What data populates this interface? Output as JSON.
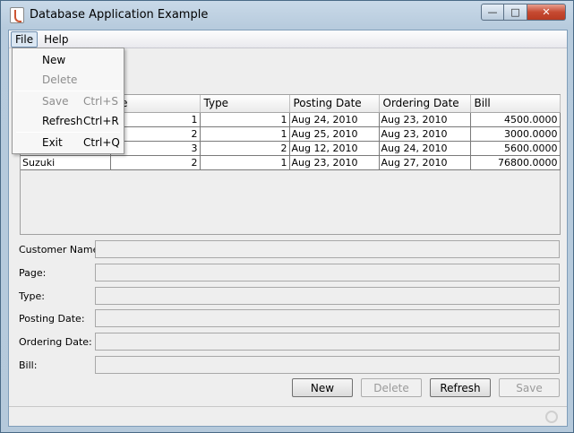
{
  "window": {
    "title": "Database Application Example"
  },
  "window_controls": {
    "minimize": "—",
    "maximize": "□",
    "close": "✕"
  },
  "menubar": {
    "items": [
      {
        "label": "File"
      },
      {
        "label": "Help"
      }
    ]
  },
  "file_menu": {
    "items": [
      {
        "label": "New",
        "accelerator": "",
        "enabled": true
      },
      {
        "label": "Delete",
        "accelerator": "",
        "enabled": false
      },
      {
        "label": "Save",
        "accelerator": "Ctrl+S",
        "enabled": false
      },
      {
        "label": "Refresh",
        "accelerator": "Ctrl+R",
        "enabled": true
      },
      {
        "label": "Exit",
        "accelerator": "Ctrl+Q",
        "enabled": true
      }
    ]
  },
  "table": {
    "columns": [
      "",
      "ge",
      "Type",
      "Posting Date",
      "Ordering Date",
      "Bill"
    ],
    "rows": [
      [
        "",
        "1",
        "1",
        "Aug 24, 2010",
        "Aug 23, 2010",
        "4500.0000"
      ],
      [
        "",
        "2",
        "1",
        "Aug 25, 2010",
        "Aug 23, 2010",
        "3000.0000"
      ],
      [
        "",
        "3",
        "2",
        "Aug 12, 2010",
        "Aug 24, 2010",
        "5600.0000"
      ],
      [
        "Suzuki",
        "2",
        "1",
        "Aug 23, 2010",
        "Aug 27, 2010",
        "76800.0000"
      ]
    ]
  },
  "form": {
    "fields": [
      {
        "label": "Customer Name:",
        "value": ""
      },
      {
        "label": "Page:",
        "value": ""
      },
      {
        "label": "Type:",
        "value": ""
      },
      {
        "label": "Posting Date:",
        "value": ""
      },
      {
        "label": "Ordering Date:",
        "value": ""
      },
      {
        "label": "Bill:",
        "value": ""
      }
    ]
  },
  "buttons": {
    "new": "New",
    "delete": "Delete",
    "refresh": "Refresh",
    "save": "Save"
  },
  "colors": {
    "titlebar": "#b7cbdd",
    "close_button": "#c64a32",
    "menu_active": "#dbe7f3"
  }
}
